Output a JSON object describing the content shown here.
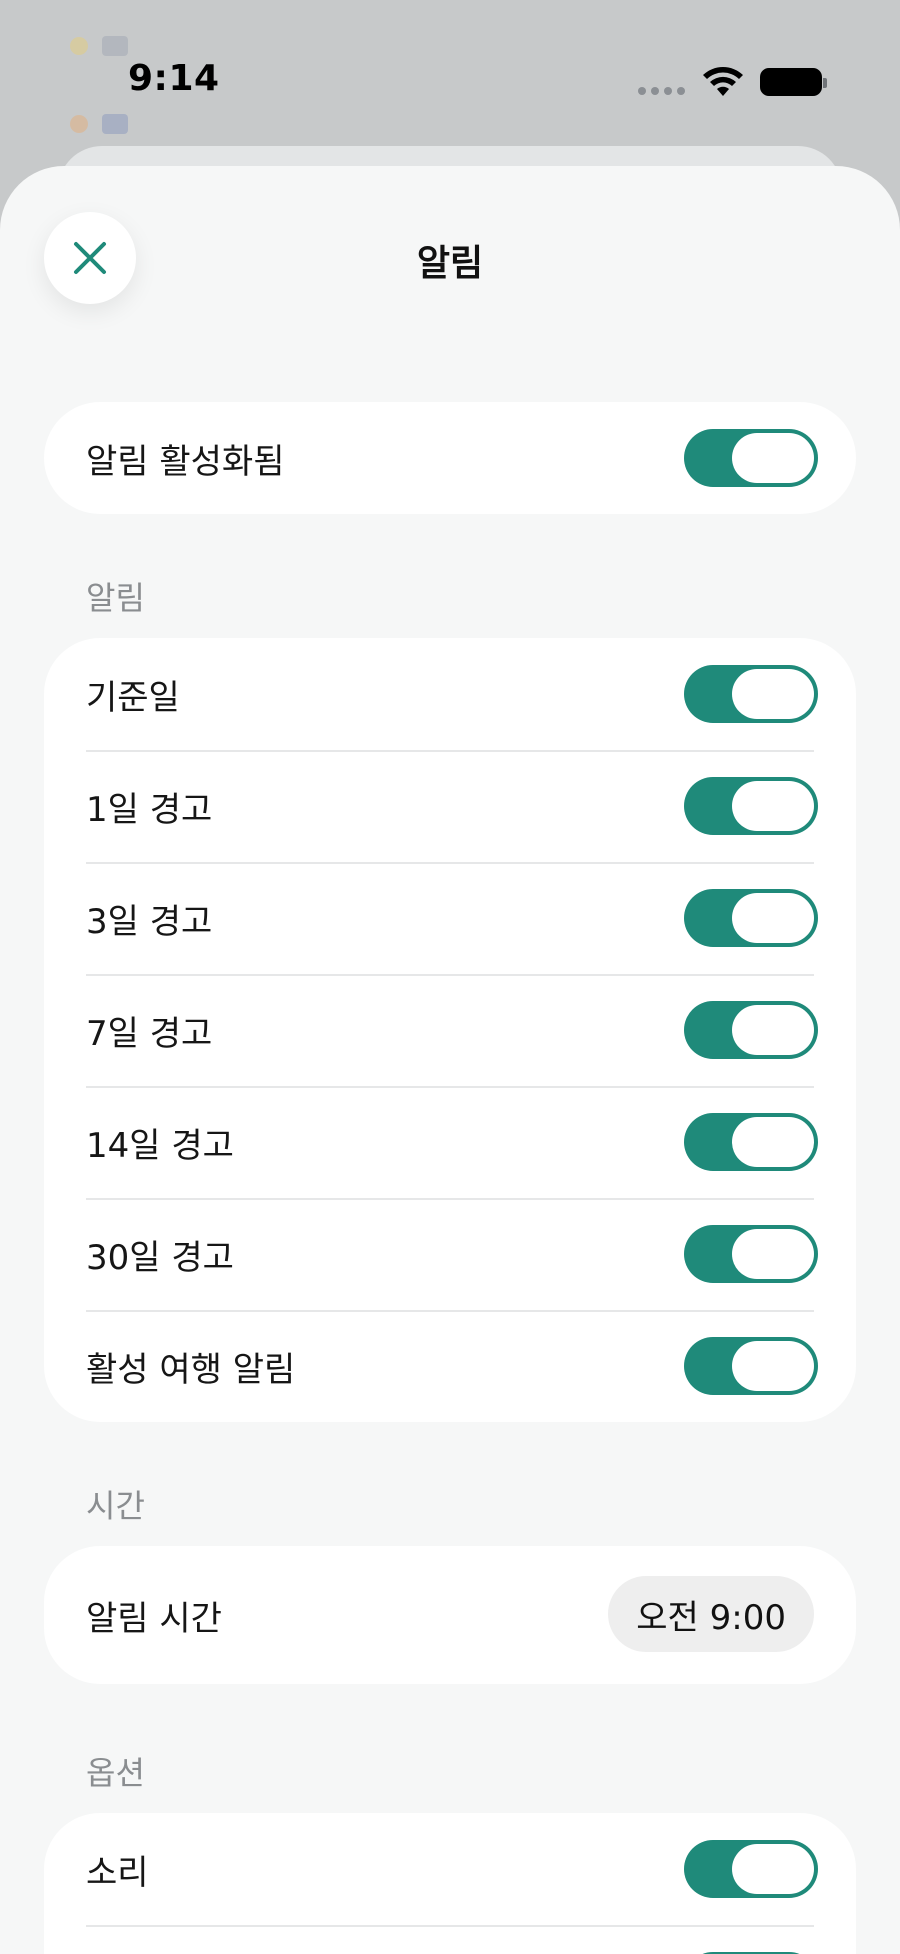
{
  "status_bar": {
    "time": "9:14"
  },
  "sheet": {
    "title": "알림"
  },
  "master": {
    "label": "알림 활성화됨",
    "on": true
  },
  "sections": {
    "alerts": {
      "header": "알림",
      "items": [
        {
          "label": "기준일",
          "on": true
        },
        {
          "label": "1일 경고",
          "on": true
        },
        {
          "label": "3일 경고",
          "on": true
        },
        {
          "label": "7일 경고",
          "on": true
        },
        {
          "label": "14일 경고",
          "on": true
        },
        {
          "label": "30일 경고",
          "on": true
        },
        {
          "label": "활성 여행 알림",
          "on": true
        }
      ]
    },
    "time": {
      "header": "시간",
      "label": "알림 시간",
      "value": "오전 9:00"
    },
    "options": {
      "header": "옵션",
      "items": [
        {
          "label": "소리",
          "on": true
        }
      ]
    }
  },
  "colors": {
    "accent": "#1f8a7a",
    "sheet_bg": "#f6f7f7",
    "card_bg": "#ffffff",
    "section_header": "#8a8d90"
  },
  "icons": {
    "close": "close-icon",
    "wifi": "wifi-icon",
    "battery": "battery-icon"
  }
}
